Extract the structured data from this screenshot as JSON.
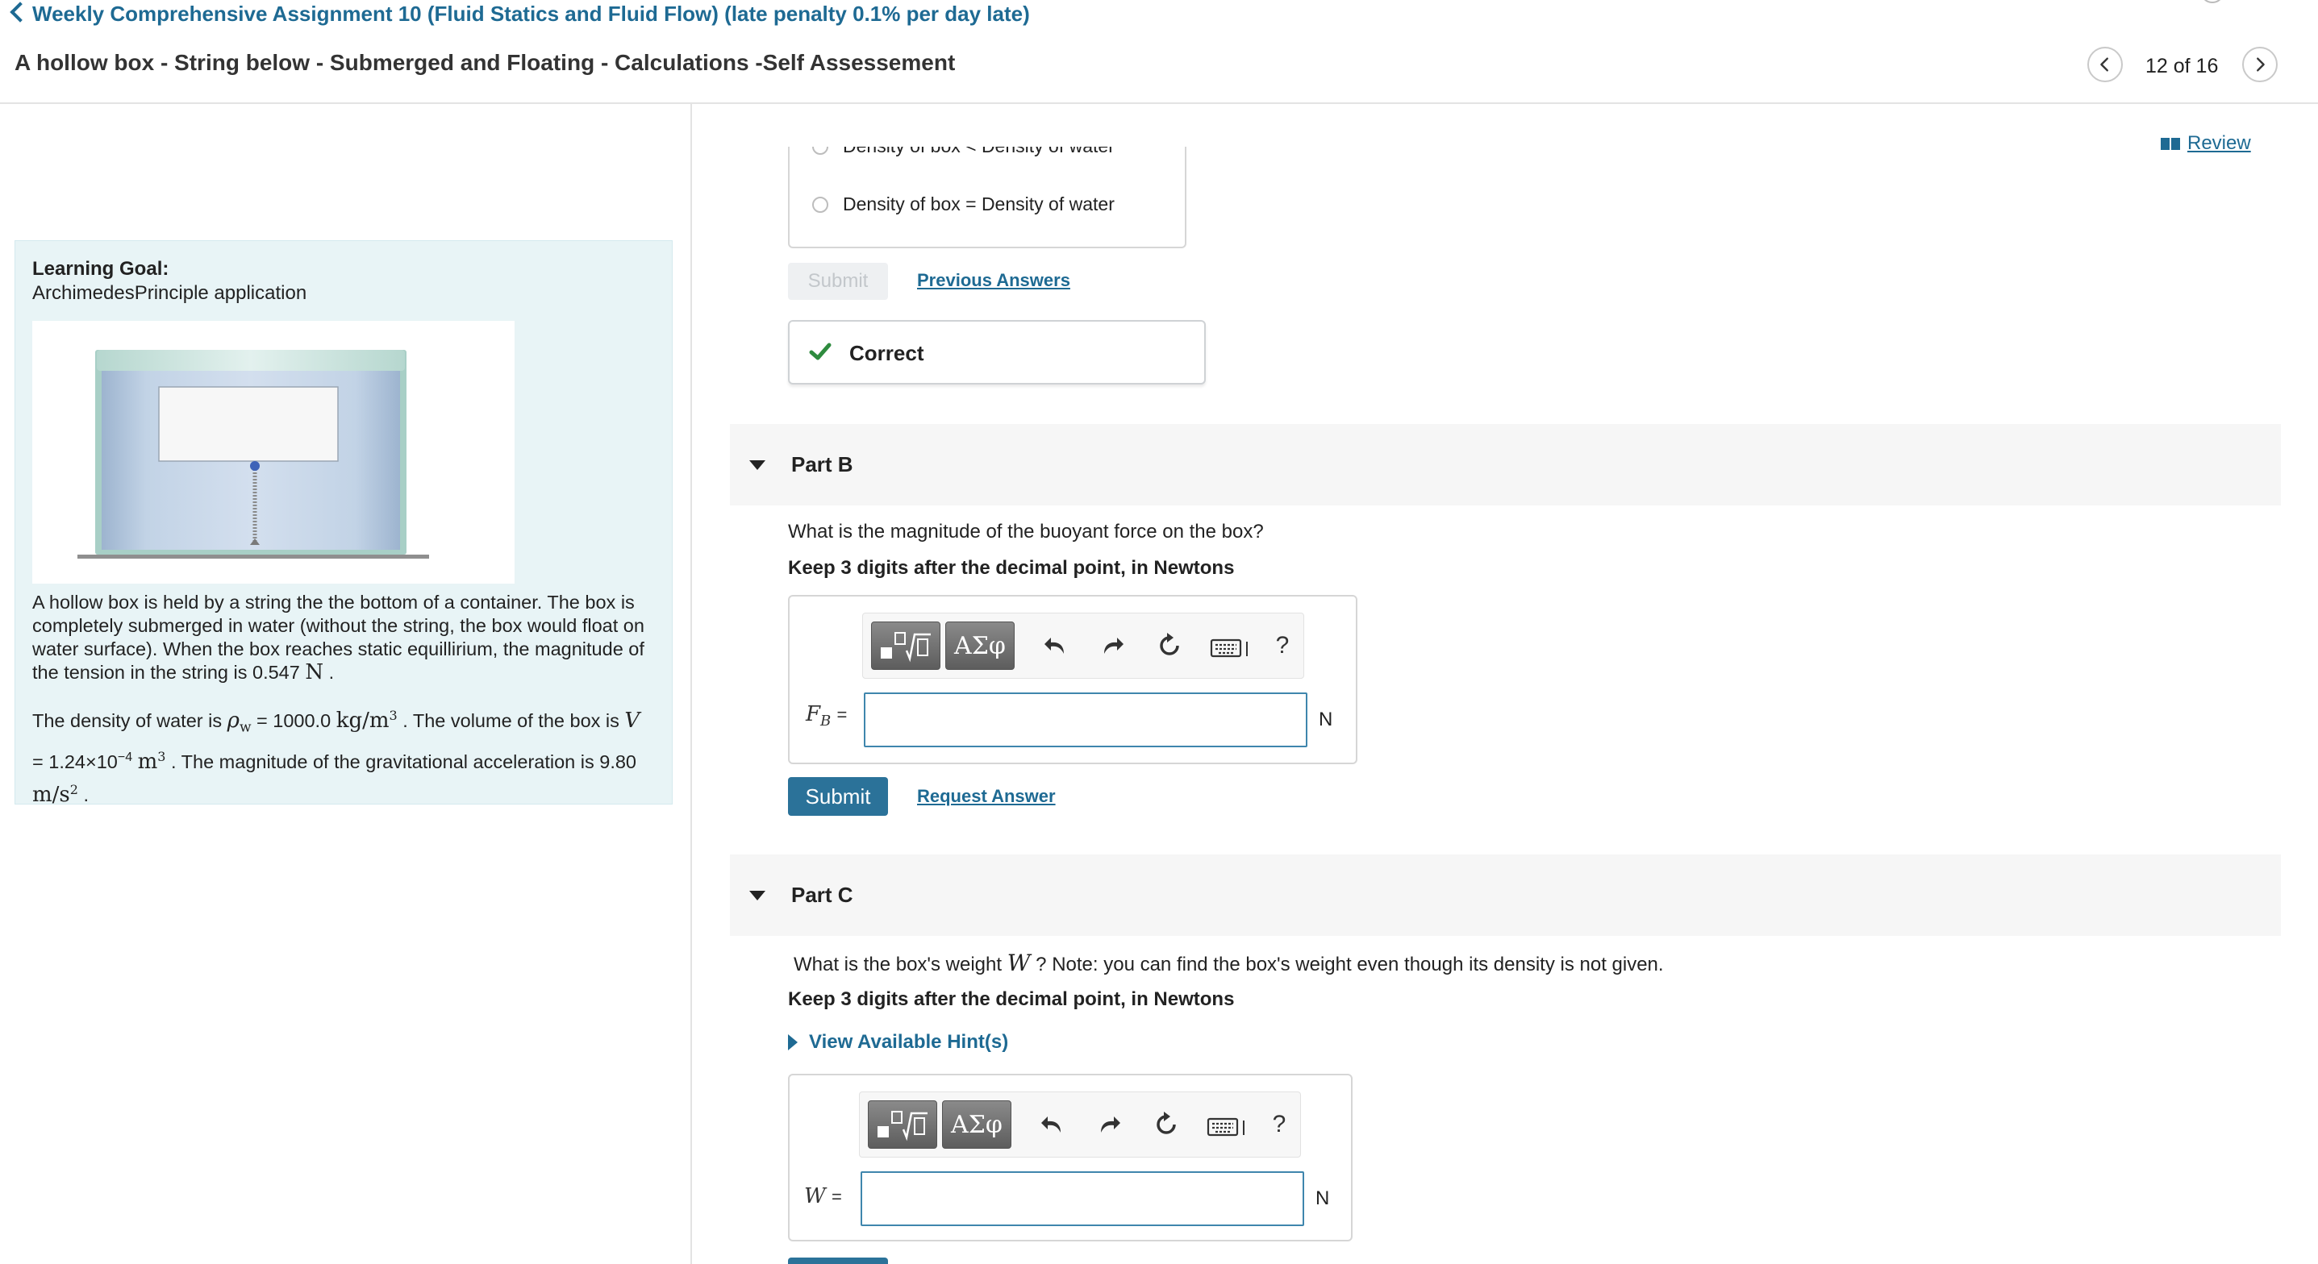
{
  "header": {
    "assignment_link": "Weekly Comprehensive Assignment 10 (Fluid Statics and Fluid Flow) (late penalty 0.1% per day late)",
    "page_title": "A hollow box - String below - Submerged and Floating - Calculations -Self Assessement",
    "pager": "12 of 16"
  },
  "review_label": "Review",
  "intro": {
    "goal_heading": "Learning Goal:",
    "goal_text": "ArchimedesPrinciple application",
    "para1": "A hollow box is held by a string the the bottom of a container. The box is completely submerged in water (without the string, the box would float on water surface). When the box reaches static equillirium, the magnitude of the tension in the string is 0.547",
    "para1_unit": "N",
    "para2_a": "The density of water is",
    "rho_symbol": "ρ",
    "rho_sub": "w",
    "para2_rho_val": "= 1000.0",
    "density_unit": "kg/m",
    "density_exp": "3",
    "para2_b": ". The volume of the box is",
    "vol_symbol": "V",
    "para2_vol_val": "= 1.24×10",
    "vol_exp": "−4",
    "vol_unit": "m",
    "vol_unit_exp": "3",
    "para2_c": ". The magnitude of the gravitational acceleration is 9.80",
    "g_unit": "m/s",
    "g_exp": "2",
    "period": "."
  },
  "part_a": {
    "option_partial": "Density of box < Density of water",
    "option_equal": "Density of box = Density of water",
    "submit_label": "Submit",
    "previous_answers": "Previous Answers",
    "feedback": "Correct"
  },
  "part_b": {
    "label": "Part B",
    "question": "What is the magnitude of the buoyant force on the box?",
    "instruction": "Keep 3 digits after the decimal point, in Newtons",
    "var_symbol": "F",
    "var_sub": "B",
    "equals": "=",
    "unit": "N",
    "submit_label": "Submit",
    "request_answer": "Request Answer"
  },
  "part_c": {
    "label": "Part C",
    "question_a": "What is the box's weight",
    "var_symbol": "W",
    "question_b": "? Note: you can find the box's weight even though its density is not given.",
    "instruction": "Keep 3 digits after the decimal point, in Newtons",
    "hints": "View Available Hint(s)",
    "equals": "=",
    "unit": "N"
  },
  "toolbar": {
    "greek_label": "ΑΣφ",
    "help_label": "?"
  },
  "colors": {
    "accent": "#1e6a93",
    "primary_button": "#2b7299",
    "correct_green": "#2e8b3e",
    "intro_panel_bg": "#e8f4f6",
    "part_band_bg": "#f6f6f6"
  }
}
